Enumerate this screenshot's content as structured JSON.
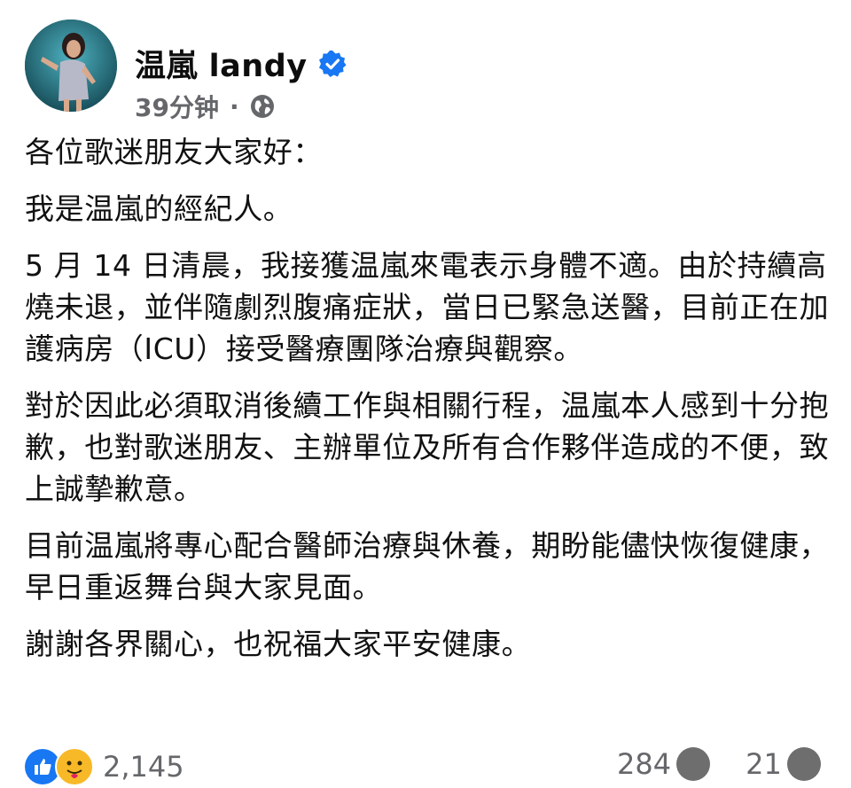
{
  "post": {
    "author": "温嵐 landy",
    "time": "39分钟",
    "separator": "·",
    "verified_icon": "verified-badge-icon",
    "privacy_icon": "globe-icon"
  },
  "body": {
    "paragraphs": [
      "各位歌迷朋友大家好：",
      "我是温嵐的經紀人。",
      "5 月 14 日清晨，我接獲温嵐來電表示身體不適。由於持續高燒未退，並伴隨劇烈腹痛症狀，當日已緊急送醫，目前正在加護病房（ICU）接受醫療團隊治療與觀察。",
      "對於因此必須取消後續工作與相關行程，温嵐本人感到十分抱歉，也對歌迷朋友、主辦單位及所有合作夥伴造成的不便，致上誠摯歉意。",
      "目前温嵐將專心配合醫師治療與休養，期盼能儘快恢復健康，早日重返舞台與大家見面。",
      "謝謝各界關心，也祝福大家平安健康。"
    ]
  },
  "footer": {
    "reaction_count": "2,145",
    "comments_count": "284",
    "shares_count": "21",
    "colors": {
      "like": "#1877f2",
      "care": "#f7b928",
      "verified": "#1877f2"
    }
  }
}
